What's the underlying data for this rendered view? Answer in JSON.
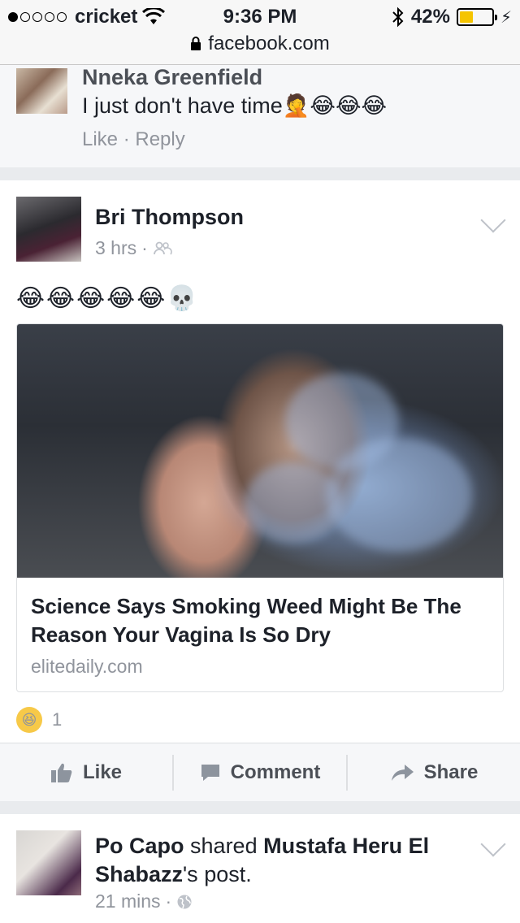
{
  "status_bar": {
    "carrier": "cricket",
    "time": "9:36 PM",
    "battery_percent": "42%",
    "battery_level": 0.42,
    "battery_color": "#f5c400"
  },
  "browser": {
    "url": "facebook.com"
  },
  "comment": {
    "author": "Nneka Greenfield",
    "text": "I just don't have time",
    "emoji": "🤦😂😂😂",
    "actions": {
      "like": "Like",
      "separator": "·",
      "reply": "Reply"
    }
  },
  "post": {
    "author": "Bri Thompson",
    "time": "3 hrs",
    "meta_separator": "·",
    "privacy_icon": "friends-icon",
    "emojis": "😂😂😂😂😂💀",
    "link": {
      "title": "Science Says Smoking Weed Might Be The Reason Your Vagina Is So Dry",
      "domain": "elitedaily.com"
    },
    "reactions": {
      "emoji": "😆",
      "count": "1"
    },
    "actions": {
      "like": "Like",
      "comment": "Comment",
      "share": "Share"
    }
  },
  "next_post": {
    "author": "Po Capo",
    "verb": "shared",
    "shared_from": "Mustafa Heru El Shabazz",
    "suffix": "'s post.",
    "time": "21 mins",
    "meta_separator": "·",
    "privacy_icon": "globe-icon"
  }
}
